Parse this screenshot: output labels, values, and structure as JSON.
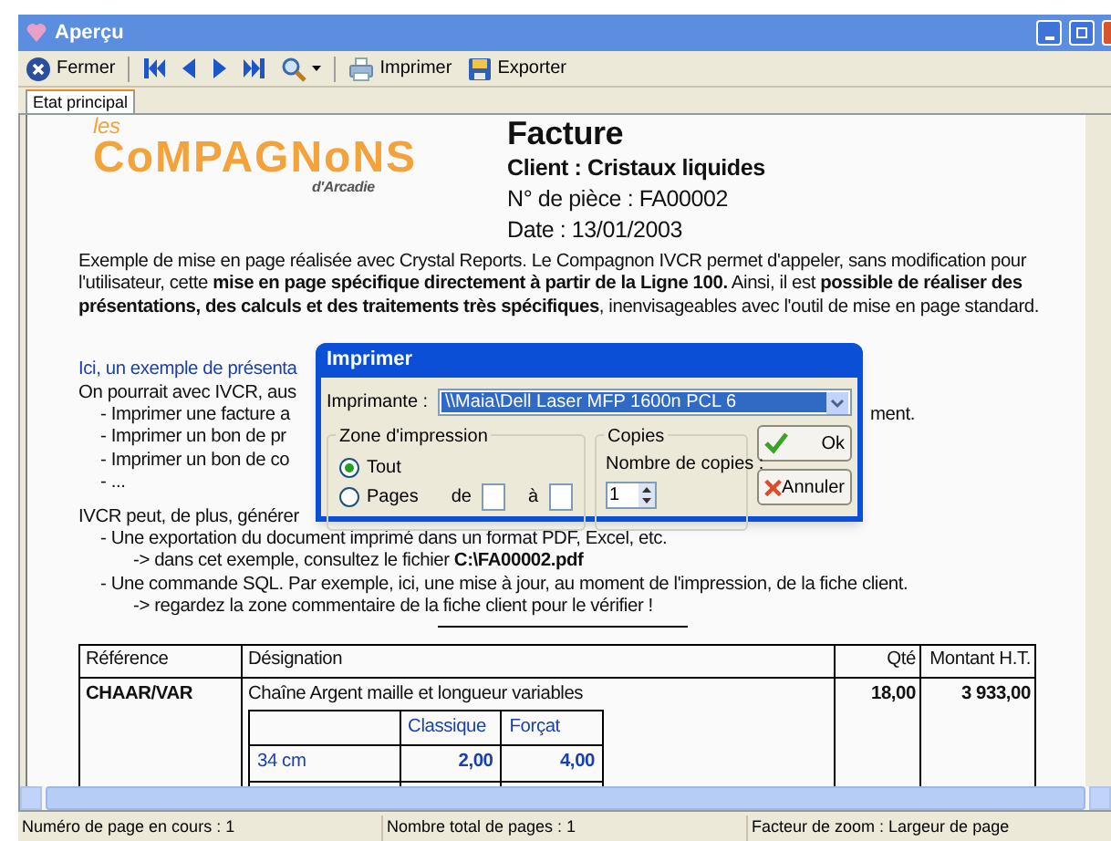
{
  "window": {
    "title": "Aperçu"
  },
  "toolbar": [
    {
      "kind": "close",
      "label": "Fermer"
    },
    {
      "kind": "first"
    },
    {
      "kind": "prev"
    },
    {
      "kind": "next"
    },
    {
      "kind": "last"
    },
    {
      "kind": "zoom"
    },
    {
      "kind": "print",
      "label": "Imprimer"
    },
    {
      "kind": "export",
      "label": "Exporter"
    }
  ],
  "tabs": [
    {
      "label": "Etat principal",
      "selected": true
    }
  ],
  "report": {
    "logo": {
      "small": "les",
      "main": "CoMPAGNoNS",
      "sub": "d'Arcadie"
    },
    "title": "Facture",
    "client": "Client : Cristaux liquides",
    "piece": "N° de pièce : FA00002",
    "date": "Date : 13/01/2003",
    "intro": "Exemple de mise en page réalisée avec Crystal Reports. Le Compagnon IVCR permet d'appeler, sans modification pour l'utilisateur, cette **mise en page spécifique directement à partir de la Ligne 100.** Ainsi, il est **possible de réaliser des présentations, des calculs et des traitements très spécifiques**, inenvisageables avec l'outil de mise en page standard.",
    "lines": [
      {
        "kind": "link",
        "text": "Ici, un exemple de présenta"
      },
      {
        "kind": "para",
        "text": "On pourrait avec IVCR, aus"
      },
      {
        "kind": "bullet",
        "text": "- Imprimer une facture a",
        "tail": "ment."
      },
      {
        "kind": "bullet",
        "text": "- Imprimer un bon de pr"
      },
      {
        "kind": "bullet",
        "text": "- Imprimer un bon de co"
      },
      {
        "kind": "bullet",
        "text": "- ..."
      },
      {
        "kind": "gap"
      },
      {
        "kind": "para",
        "text": "IVCR peut, de plus, générer"
      },
      {
        "kind": "bullet",
        "text": "- Une exportation du document imprimé dans un format PDF, Excel, etc."
      },
      {
        "kind": "sub",
        "text": "-> dans cet exemple, consultez le fichier **C:\\FA00002.pdf**"
      },
      {
        "kind": "bullet",
        "text": "- Une commande SQL. Par exemple, ici, une mise à jour, au moment de l'impression, de la fiche client."
      },
      {
        "kind": "sub",
        "text": "-> regardez la zone commentaire de la fiche client pour le vérifier !"
      }
    ],
    "table": {
      "columns": [
        "Référence",
        "Désignation",
        "Qté",
        "Montant H.T."
      ],
      "rows": [
        {
          "reference": "CHAAR/VAR",
          "designation": "Chaîne Argent maille et longueur variables",
          "qty": "18,00",
          "amount": "3 933,00",
          "sizes": {
            "columns": [
              "Classique",
              "Forçat"
            ],
            "rows": [
              {
                "size": "34 cm",
                "values": [
                  "2,00",
                  "4,00"
                ]
              }
            ]
          }
        }
      ]
    }
  },
  "dialog": {
    "title": "Imprimer",
    "printer_label": "Imprimante :",
    "printer": "\\\\Maia\\Dell Laser MFP 1600n PCL 6",
    "range_group": "Zone d'impression",
    "options": [
      {
        "label": "Tout",
        "selected": true
      },
      {
        "label": "Pages",
        "selected": false
      }
    ],
    "from_label": "de",
    "to_label": "à",
    "copies_group": "Copies",
    "copies_label": "Nombre de copies :",
    "copies": "1",
    "buttons": [
      {
        "kind": "ok",
        "label": "Ok"
      },
      {
        "kind": "cancel",
        "label": "Annuler"
      }
    ]
  },
  "status_bar": [
    "Numéro de page en cours : 1",
    "Nombre total de pages : 1",
    "Facteur de zoom : Largeur de page"
  ]
}
